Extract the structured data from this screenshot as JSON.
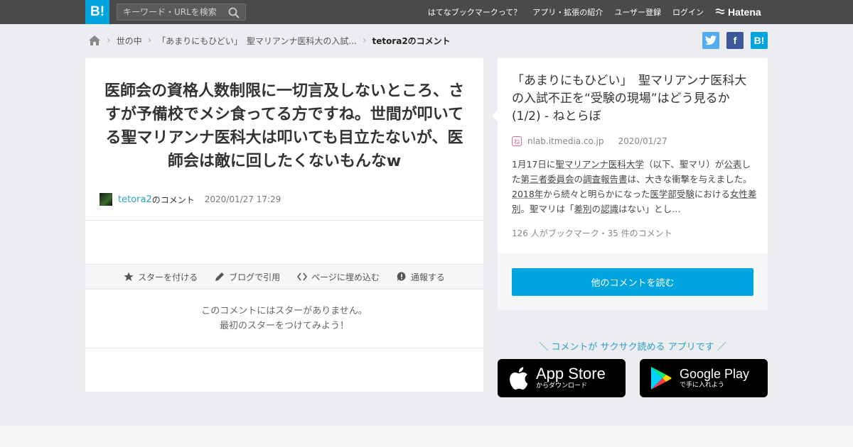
{
  "header": {
    "logo": "B!",
    "search_placeholder": "キーワード・URLを検索",
    "nav": [
      "はてなブックマークって？",
      "アプリ・拡張の紹介",
      "ユーザー登録",
      "ログイン"
    ],
    "brand": "Hatena"
  },
  "breadcrumb": {
    "items": [
      "世の中",
      "「あまりにもひどい」　聖マリアンナ医科大の入試..."
    ],
    "current": "tetora2のコメント"
  },
  "share": {
    "facebook": "f",
    "hatena": "B!"
  },
  "comment": {
    "text": "医師会の資格人数制限に一切言及しないところ、さすが予備校でメシ食ってる方ですね。世間が叩いてる聖マリアンナ医科大は叩いても目立たないが、医師会は敵に回したくないもんなw",
    "user": "tetora2",
    "user_suffix": "のコメント",
    "datetime": "2020/01/27 17:29"
  },
  "actions": [
    "スターを付ける",
    "ブログで引用",
    "ページに埋め込む",
    "通報する"
  ],
  "no_stars": {
    "line1": "このコメントにはスターがありません。",
    "line2": "最初のスターをつけてみよう！"
  },
  "entry": {
    "title": "「あまりにもひどい」　聖マリアンナ医科大の入試不正を“受験の現場”はどう見るか (1/2) - ねとらぼ",
    "favicon": "ね",
    "domain": "nlab.itmedia.co.jp",
    "date": "2020/01/27",
    "summary_parts": [
      {
        "t": "1月17日に",
        "u": false
      },
      {
        "t": "聖マリアンナ医科大学",
        "u": true
      },
      {
        "t": "（以下、聖マリ）が",
        "u": false
      },
      {
        "t": "公表",
        "u": true
      },
      {
        "t": "した",
        "u": false
      },
      {
        "t": "第三者委員会",
        "u": true
      },
      {
        "t": "の",
        "u": false
      },
      {
        "t": "調査報告書",
        "u": true
      },
      {
        "t": "は、大きな衝撃を与えました。",
        "u": false
      },
      {
        "t": "2018年",
        "u": true
      },
      {
        "t": "から続々と明らかになった",
        "u": false
      },
      {
        "t": "医学部受験",
        "u": true
      },
      {
        "t": "における",
        "u": false
      },
      {
        "t": "女性差別",
        "u": true
      },
      {
        "t": "。聖マリは「",
        "u": false
      },
      {
        "t": "差別",
        "u": true
      },
      {
        "t": "の",
        "u": false
      },
      {
        "t": "認識",
        "u": true
      },
      {
        "t": "はない」とし…",
        "u": false
      }
    ],
    "counts": "126 人がブックマーク・35 件のコメント",
    "more_button": "他のコメントを読む"
  },
  "promo": {
    "text": "＼ コメントが サクサク読める アプリです ／",
    "appstore_big": "App Store",
    "appstore_small": "からダウンロード",
    "googleplay_big": "Google Play",
    "googleplay_small": "で手に入れよう"
  }
}
